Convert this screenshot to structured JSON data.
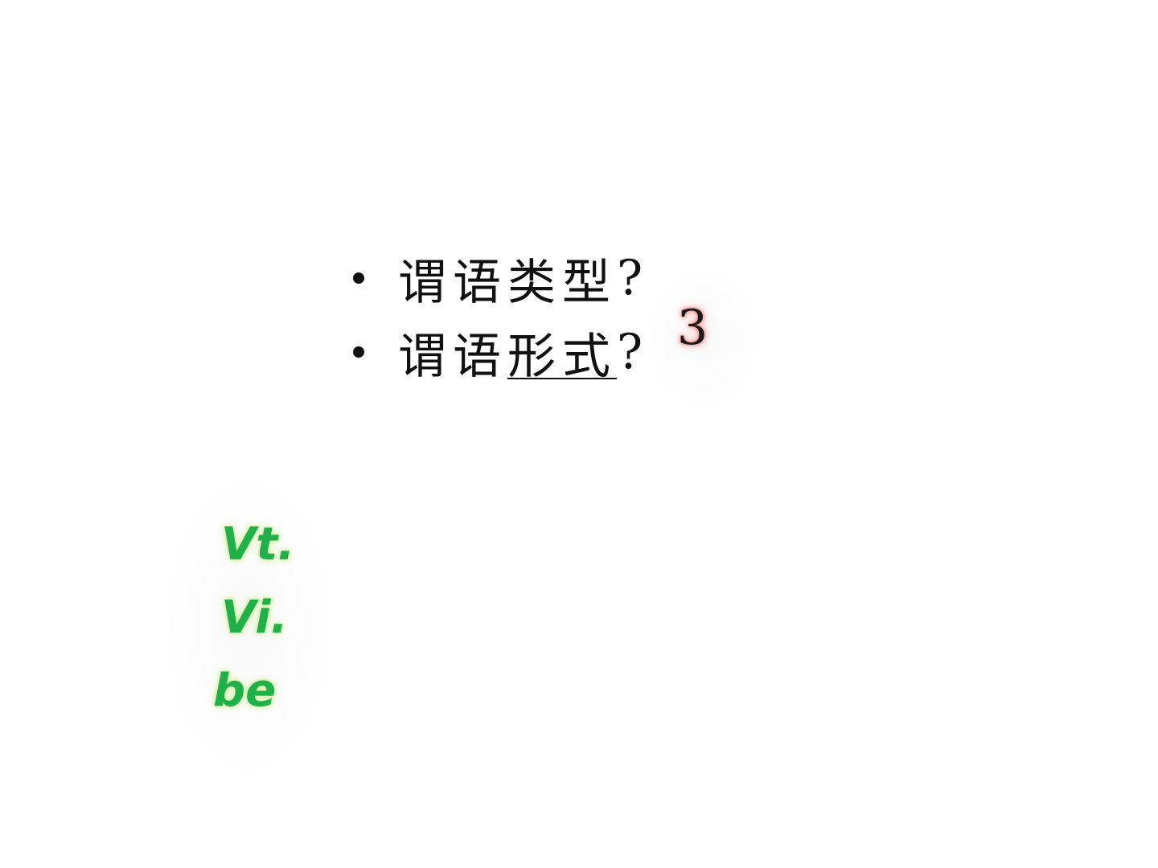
{
  "bullets": [
    {
      "prefix": "谓语类型",
      "underlined": "",
      "suffix": "?"
    },
    {
      "prefix": "谓语",
      "underlined": "形式",
      "suffix": "?"
    }
  ],
  "badge": {
    "number": "3",
    "glow_color": "#f28a8a"
  },
  "predicate_types": {
    "items": [
      "Vt.",
      "Vi.",
      "be"
    ],
    "color": "#1fb04a",
    "glow_color": "#cfeea0"
  }
}
